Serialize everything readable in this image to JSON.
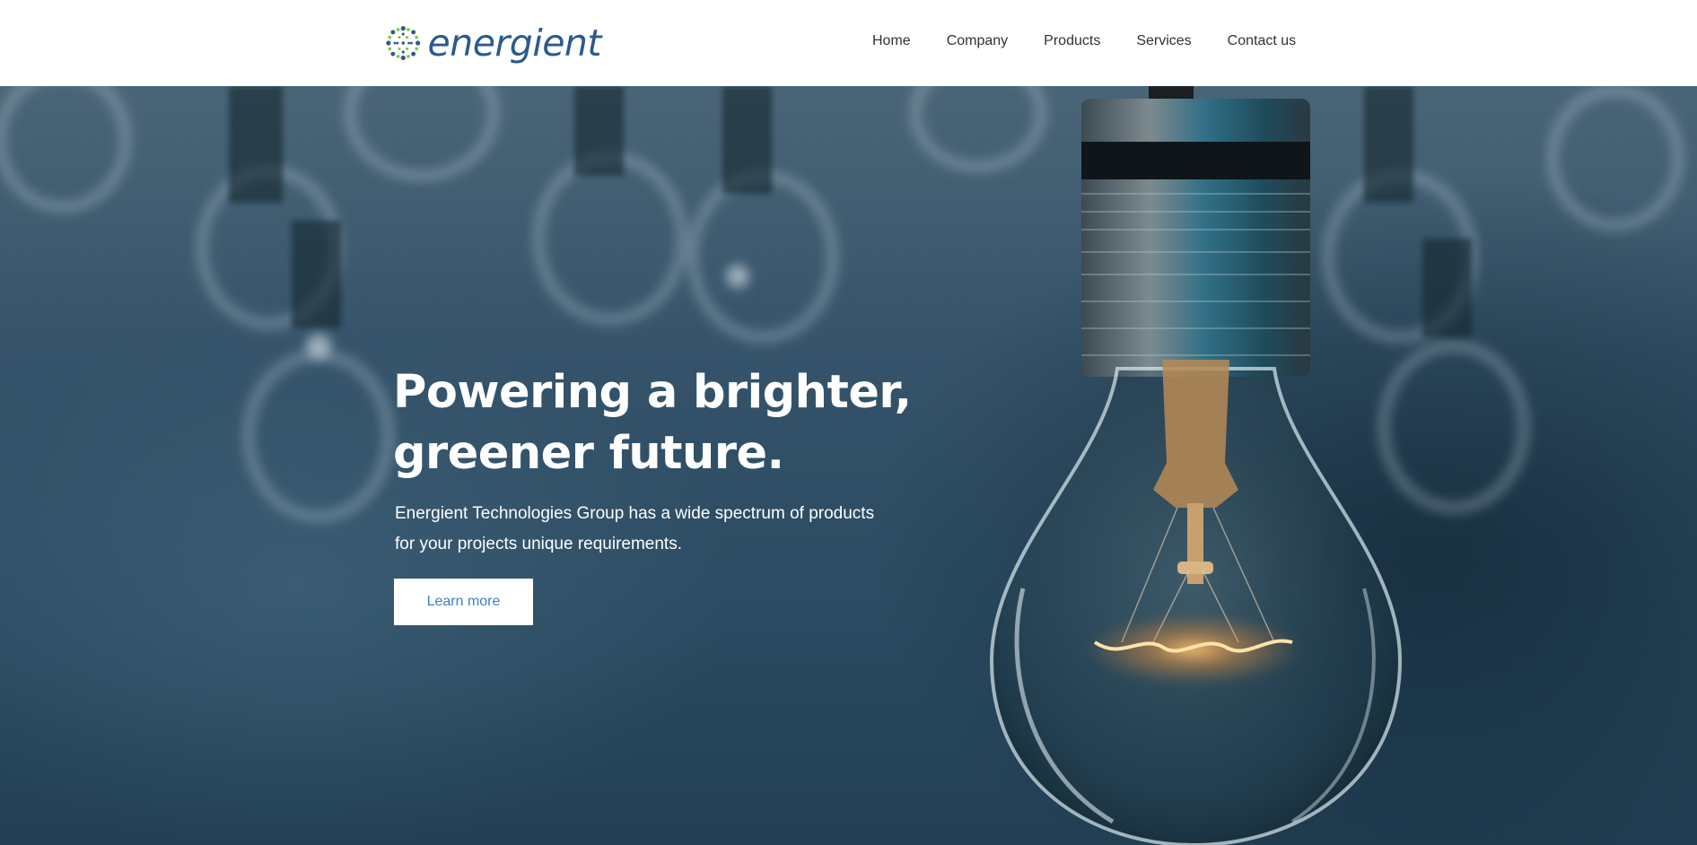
{
  "header": {
    "logo_text": "energient",
    "logo_icon": "dotted-sunburst-logo",
    "nav": [
      {
        "label": "Home"
      },
      {
        "label": "Company"
      },
      {
        "label": "Products"
      },
      {
        "label": "Services"
      },
      {
        "label": "Contact us"
      }
    ]
  },
  "hero": {
    "title_line1": "Powering a brighter,",
    "title_line2": "greener future.",
    "subtitle_line1": "Energient Technologies Group has a wide spectrum of products",
    "subtitle_line2": "for your projects unique requirements.",
    "cta_label": "Learn more",
    "background_image": "hanging-light-bulbs"
  },
  "colors": {
    "brand_blue": "#2b5a8e",
    "brand_green": "#8dc63f",
    "cta_text": "#3a7fcf",
    "hero_bg": "#2b4a5e",
    "nav_text": "#333333"
  }
}
